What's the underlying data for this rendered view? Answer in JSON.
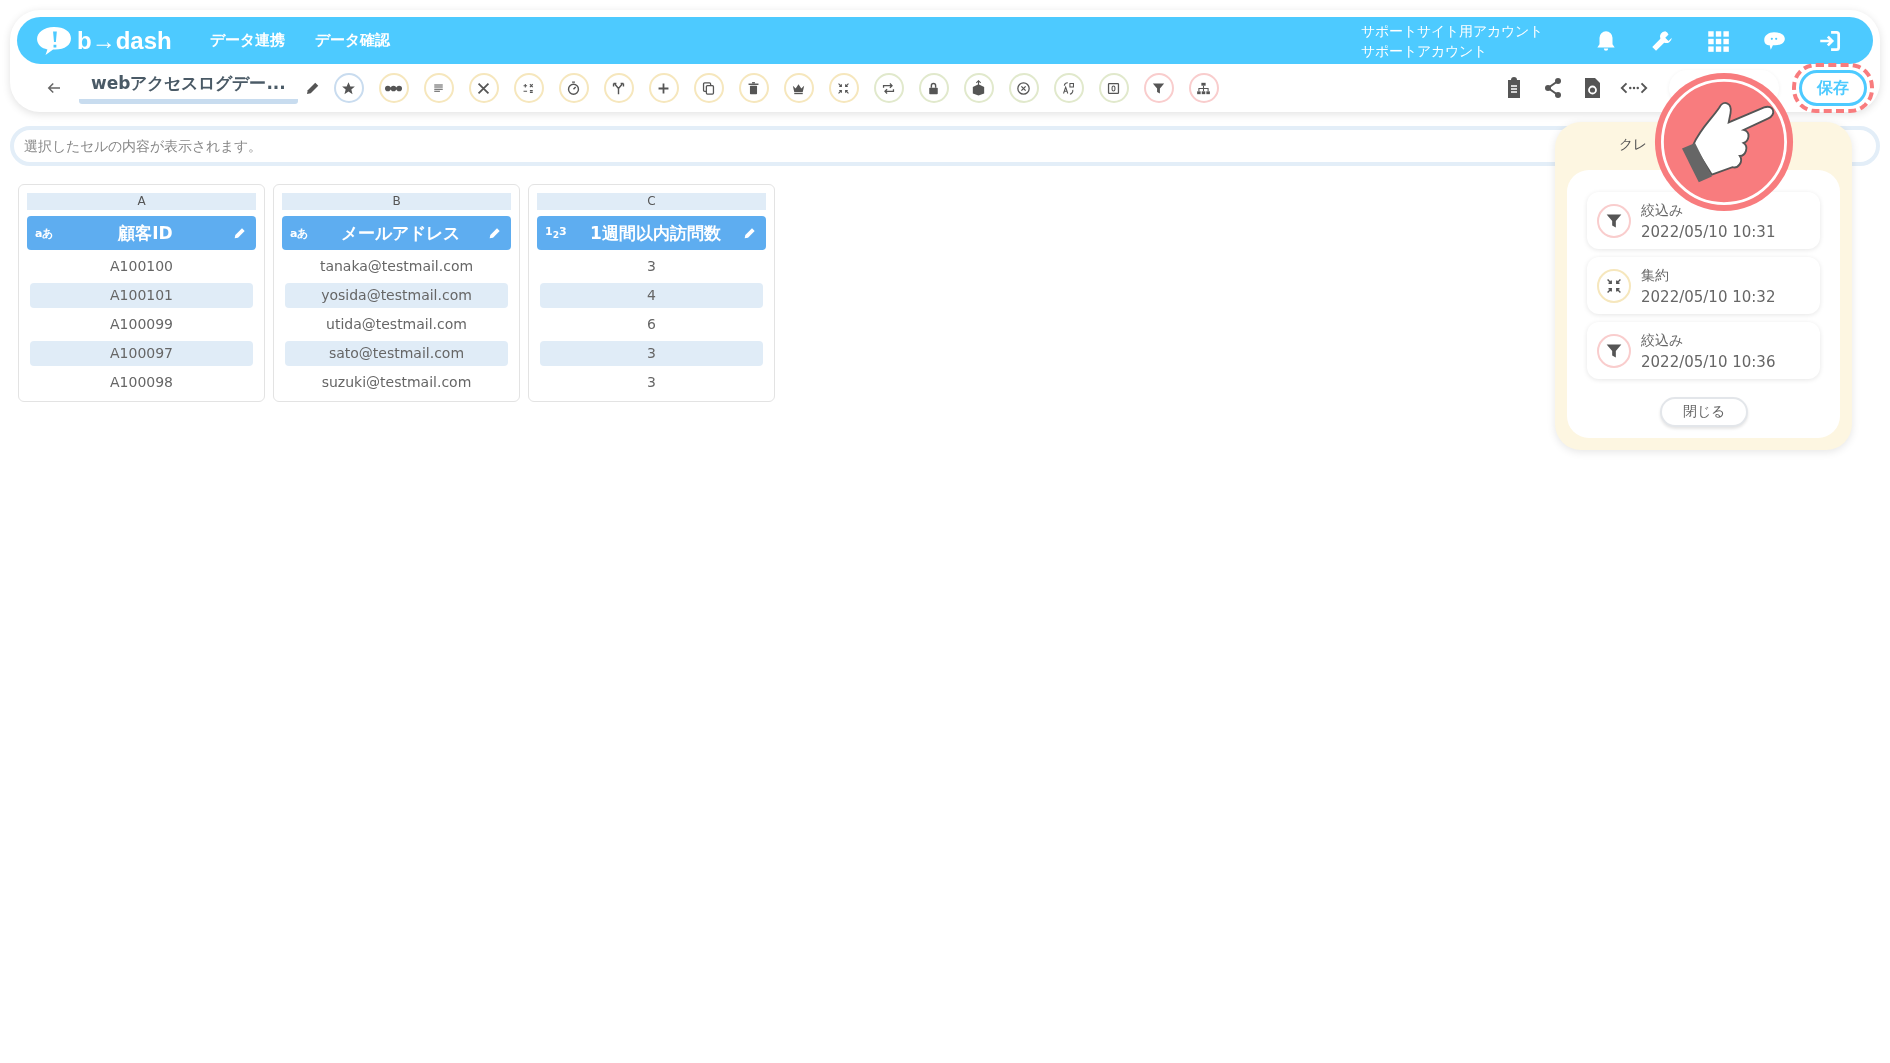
{
  "header": {
    "logo": "b→dash",
    "nav": [
      {
        "label": "データ連携"
      },
      {
        "label": "データ確認"
      }
    ],
    "account": {
      "site": "サポートサイト用アカウント",
      "user": "サポートアカウント"
    }
  },
  "toolbar": {
    "title": "webアクセスログデー...",
    "tools": [
      {
        "color": "#c9dcef"
      },
      {
        "color": "#f6e7bd"
      },
      {
        "color": "#f6e7bd"
      },
      {
        "color": "#f6e7bd"
      },
      {
        "color": "#f6e7bd"
      },
      {
        "color": "#f6e7bd"
      },
      {
        "color": "#f6e7bd"
      },
      {
        "color": "#f6e7bd"
      },
      {
        "color": "#f6e7bd"
      },
      {
        "color": "#f6e7bd"
      },
      {
        "color": "#f6e7bd"
      },
      {
        "color": "#f6e7bd"
      },
      {
        "color": "#e1e9cc"
      },
      {
        "color": "#e1e9cc"
      },
      {
        "color": "#e1e9cc"
      },
      {
        "color": "#e1e9cc"
      },
      {
        "color": "#e1e9cc"
      },
      {
        "color": "#e1e9cc"
      },
      {
        "color": "#f9cdcd"
      },
      {
        "color": "#f9cdcd"
      }
    ],
    "save": "保存"
  },
  "formula_bar": {
    "placeholder": "選択したセルの内容が表示されます。"
  },
  "table": {
    "columns": [
      {
        "letter": "A",
        "type_badge": "aあ",
        "name": "顧客ID"
      },
      {
        "letter": "B",
        "type_badge": "aあ",
        "name": "メールアドレス"
      },
      {
        "letter": "C",
        "type_badge": "1$_{2}$3",
        "name": "1週間以内訪問数"
      }
    ],
    "rows": [
      [
        "A100100",
        "tanaka@testmail.com",
        "3"
      ],
      [
        "A100101",
        "yosida@testmail.com",
        "4"
      ],
      [
        "A100099",
        "utida@testmail.com",
        "6"
      ],
      [
        "A100097",
        "sato@testmail.com",
        "3"
      ],
      [
        "A100098",
        "suzuki@testmail.com",
        "3"
      ]
    ]
  },
  "popup": {
    "title": "クレ",
    "entries": [
      {
        "kind": "filter",
        "label": "絞込み",
        "time": "2022/05/10 10:31",
        "color": "#f9cdcd"
      },
      {
        "kind": "aggregate",
        "label": "集約",
        "time": "2022/05/10 10:32",
        "color": "#f6e7bd"
      },
      {
        "kind": "filter",
        "label": "絞込み",
        "time": "2022/05/10 10:36",
        "color": "#f9cdcd"
      }
    ],
    "close": "閉じる"
  }
}
